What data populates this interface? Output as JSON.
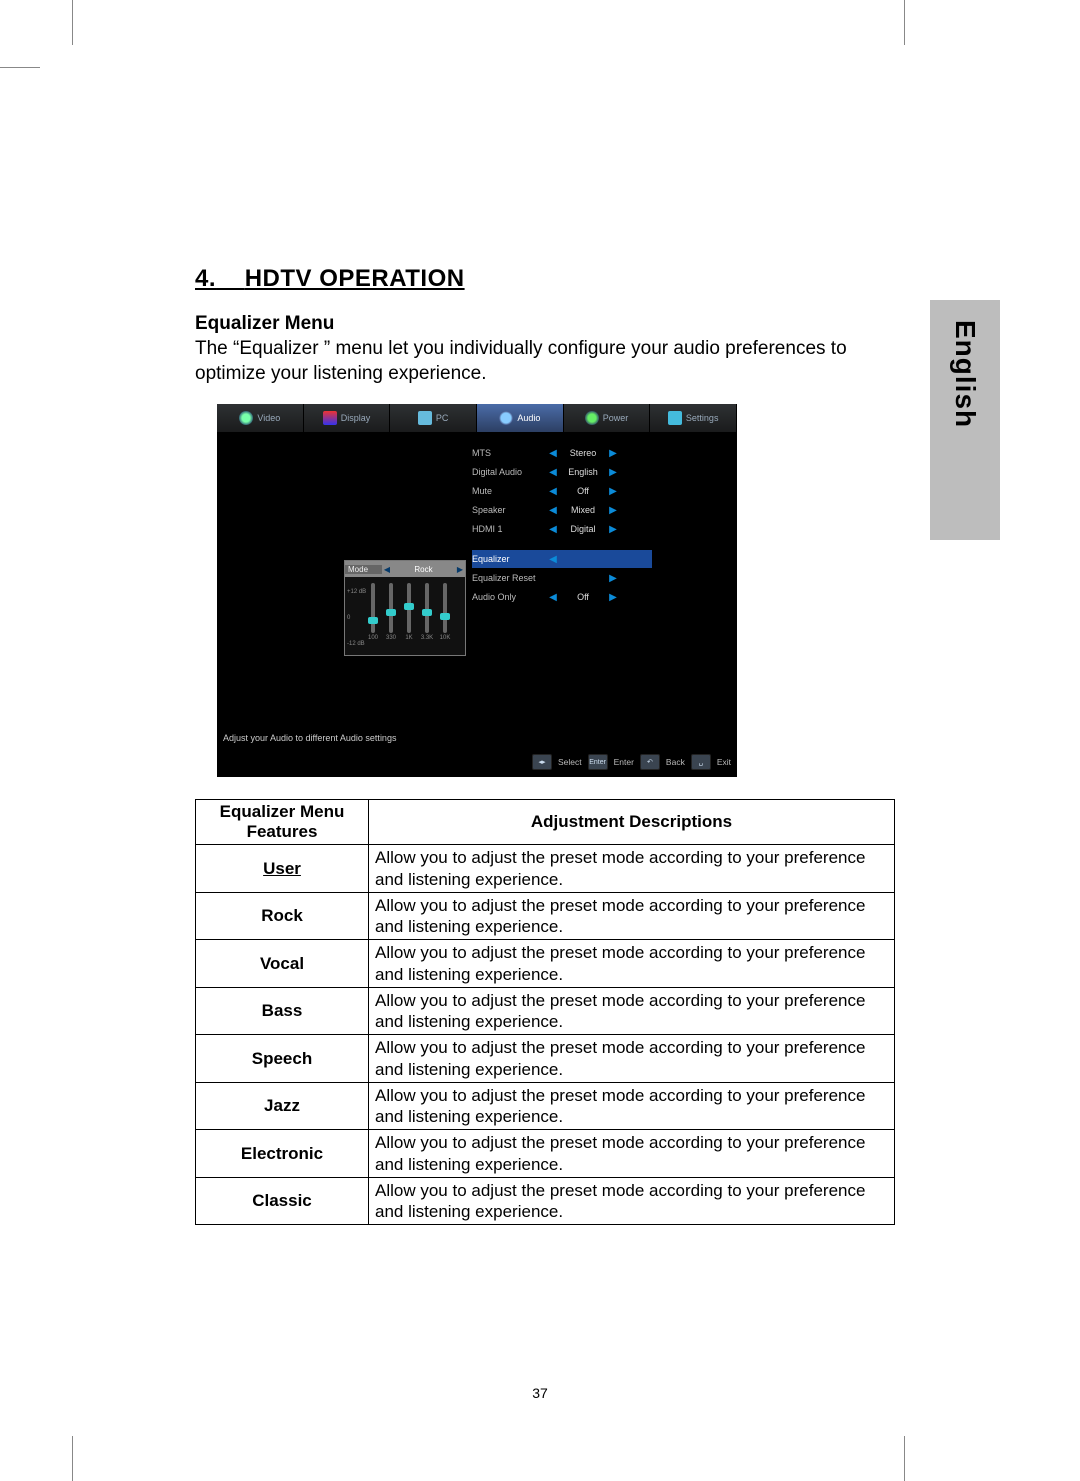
{
  "lang_tab": "English",
  "heading_num": "4.",
  "heading_text": "HDTV OPERATION",
  "subheading": "Equalizer  Menu",
  "intro": "The “Equalizer ” menu let you individually  configure your audio preferences to optimize your listening experience.",
  "page_number": "37",
  "osd": {
    "tabs": [
      "Video",
      "Display",
      "PC",
      "Audio",
      "Power",
      "Settings"
    ],
    "active_tab_index": 3,
    "rows": [
      {
        "label": "MTS",
        "value": "Stereo",
        "left": true,
        "right": true
      },
      {
        "label": "Digital Audio",
        "value": "English",
        "left": true,
        "right": true
      },
      {
        "label": "Mute",
        "value": "Off",
        "left": true,
        "right": true
      },
      {
        "label": "Speaker",
        "value": "Mixed",
        "left": true,
        "right": true
      },
      {
        "label": "HDMI 1",
        "value": "Digital",
        "left": true,
        "right": true
      }
    ],
    "rows2": [
      {
        "label": "Equalizer",
        "value": "",
        "left": true,
        "right": false,
        "highlight": true
      },
      {
        "label": "Equalizer Reset",
        "value": "",
        "left": false,
        "right": true
      },
      {
        "label": "Audio Only",
        "value": "Off",
        "left": true,
        "right": true
      }
    ],
    "eq": {
      "mode_label": "Mode",
      "mode_value": "Rock",
      "y_labels": [
        "+12 dB",
        "0",
        "-12 dB"
      ],
      "bands": [
        {
          "freq": "100",
          "pos": 34
        },
        {
          "freq": "330",
          "pos": 26
        },
        {
          "freq": "1K",
          "pos": 20
        },
        {
          "freq": "3.3K",
          "pos": 26
        },
        {
          "freq": "10K",
          "pos": 30
        }
      ]
    },
    "help_text": "Adjust your Audio to different Audio settings",
    "footer": [
      {
        "key": "◂▸",
        "label": "Select"
      },
      {
        "key": "Enter",
        "label": "Enter"
      },
      {
        "key": "↶",
        "label": "Back"
      },
      {
        "key": "␣",
        "label": "Exit"
      }
    ]
  },
  "table": {
    "head_feature": "Equalizer  Menu Features",
    "head_desc": "Adjustment Descriptions",
    "rows": [
      {
        "feature": "User",
        "underline": true,
        "desc": "Allow you to adjust the preset  mode according to your preference and  listening experience."
      },
      {
        "feature": "Rock",
        "desc": "Allow you to adjust the preset  mode according to your preference and  listening experience."
      },
      {
        "feature": "Vocal",
        "desc": "Allow you to adjust the preset  mode according to your preference and  listening experience."
      },
      {
        "feature": "Bass",
        "desc": "Allow you to adjust the preset  mode according to your preference and  listening experience."
      },
      {
        "feature": "Speech",
        "desc": "Allow you to adjust the preset  mode according to your preference and  listening experience."
      },
      {
        "feature": "Jazz",
        "desc": "Allow you to adjust the preset  mode according to your preference and  listening experience."
      },
      {
        "feature": "Electronic",
        "desc": "Allow you to adjust the preset  mode according to your preference and  listening experience."
      },
      {
        "feature": "Classic",
        "desc": "Allow you to adjust the preset  mode according to your preference and  listening experience."
      }
    ]
  }
}
